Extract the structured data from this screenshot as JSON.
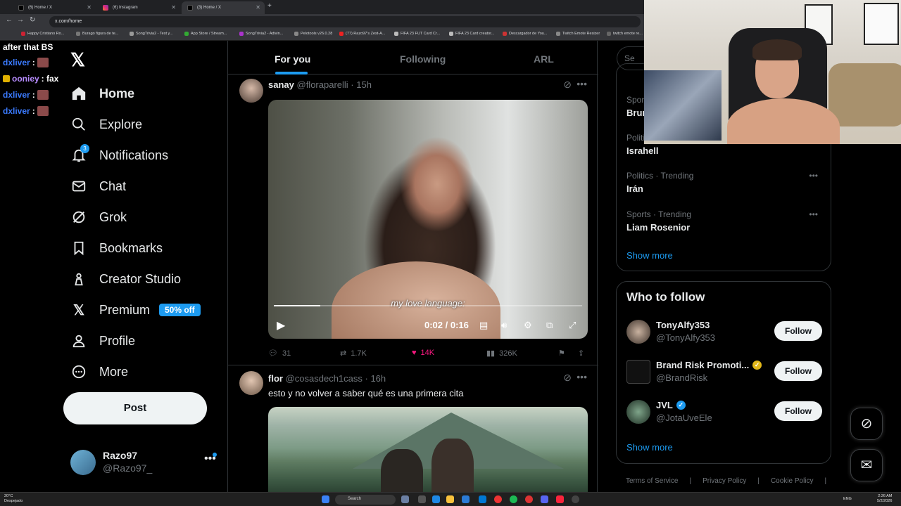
{
  "browser": {
    "tabs": [
      {
        "label": "(6) Home / X",
        "active": false
      },
      {
        "label": "(6) Instagram",
        "active": false
      },
      {
        "label": "(3) Home / X",
        "active": true
      }
    ],
    "url": "x.com/home",
    "bookmarks": [
      "Happy Cristiano Ro...",
      "Burago figura de te...",
      "SongTrivia2 - Test y...",
      "App Store / Stream...",
      "SongTrivia2 - Adivin...",
      "Pelotools v26.0.28",
      "(77) Razo97's Zest-A...",
      "FIFA 23 FUT Card Cr...",
      "FIFA 23 Card creator...",
      "Descargador de You...",
      "Twitch Emote Resizer",
      "twitch emote re..."
    ]
  },
  "chat": [
    {
      "user": "",
      "text": "after that BS",
      "color": "#ffffff"
    },
    {
      "user": "dxliver",
      "text": ":",
      "color": "#3b7bff"
    },
    {
      "user": "ooniey",
      "text": ": fax",
      "color": "#b78cff"
    },
    {
      "user": "dxliver",
      "text": ":",
      "color": "#3b7bff"
    },
    {
      "user": "dxliver",
      "text": ":",
      "color": "#3b7bff"
    }
  ],
  "nav": {
    "items": [
      {
        "label": "Home",
        "icon": "home-icon"
      },
      {
        "label": "Explore",
        "icon": "search-icon"
      },
      {
        "label": "Notifications",
        "icon": "bell-icon"
      },
      {
        "label": "Chat",
        "icon": "mail-icon"
      },
      {
        "label": "Grok",
        "icon": "grok-icon"
      },
      {
        "label": "Bookmarks",
        "icon": "bookmark-icon"
      },
      {
        "label": "Creator Studio",
        "icon": "creator-icon"
      },
      {
        "label": "Premium",
        "icon": "x-icon"
      },
      {
        "label": "Profile",
        "icon": "person-icon"
      },
      {
        "label": "More",
        "icon": "more-circle-icon"
      }
    ],
    "notifications_count": "3",
    "premium_badge": "50% off",
    "post_label": "Post",
    "account": {
      "name": "Razo97",
      "handle": "@Razo97_"
    }
  },
  "feed": {
    "tabs": [
      "For you",
      "Following",
      "ARL"
    ],
    "tweets": [
      {
        "name": "sanay",
        "handle": "@floraparelli",
        "time": "· 15h",
        "video": {
          "subtitle": "my love language:",
          "time": "0:02 / 0:16",
          "progress": 0.15
        },
        "replies": "31",
        "reposts": "1.7K",
        "likes": "14K",
        "views": "326K"
      },
      {
        "name": "flor",
        "handle": "@cosasdech1cass",
        "time": "· 16h",
        "text": "esto y no volver a saber qué es una primera cita"
      }
    ]
  },
  "sidebar": {
    "search_placeholder": "Se",
    "trends": [
      {
        "category": "Sports",
        "title": "Brun"
      },
      {
        "category": "Politics",
        "title": "Israhell"
      },
      {
        "category": "Politics · Trending",
        "title": "Irán"
      },
      {
        "category": "Sports · Trending",
        "title": "Liam Rosenior"
      }
    ],
    "show_more": "Show more",
    "who_to_follow": {
      "title": "Who to follow",
      "accounts": [
        {
          "name": "TonyAlfy353",
          "handle": "@TonyAlfy353",
          "verified": "",
          "button": "Follow"
        },
        {
          "name": "Brand Risk Promoti...",
          "handle": "@BrandRisk",
          "verified": "gold",
          "button": "Follow"
        },
        {
          "name": "JVL",
          "handle": "@JotaUveEle",
          "verified": "blue",
          "button": "Follow"
        }
      ],
      "show_more": "Show more"
    },
    "footer": [
      "Terms of Service",
      "|",
      "Privacy Policy",
      "|",
      "Cookie Policy",
      "|"
    ]
  },
  "taskbar": {
    "weather_temp": "20°C",
    "weather_desc": "Despejado",
    "search": "Search",
    "lang": "ENG",
    "time": "2:26 AM",
    "date": "5/2/2026"
  },
  "colors": {
    "accent": "#1d9bf0",
    "like": "#f91880",
    "bg": "#000000",
    "border": "#2f3336"
  }
}
